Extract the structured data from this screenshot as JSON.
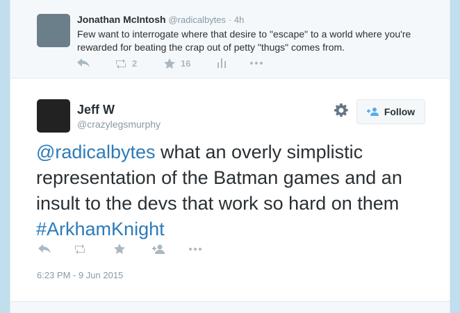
{
  "context_tweet": {
    "name": "Jonathan McIntosh",
    "handle": "@radicalbytes",
    "time": "· 4h",
    "text": "Few want to interrogate where that desire to \"escape\" to a world where you're rewarded for beating the crap out of petty \"thugs\" comes from.",
    "retweets": "2",
    "favorites": "16"
  },
  "main_tweet": {
    "name": "Jeff W",
    "handle": "@crazylegsmurphy",
    "follow_label": "Follow",
    "mention": "@radicalbytes",
    "text_body": " what an overly simplistic representation of the Batman games and an insult to the devs that work so hard on them ",
    "hashtag": "#ArkhamKnight",
    "timestamp": "6:23 PM - 9 Jun 2015"
  }
}
